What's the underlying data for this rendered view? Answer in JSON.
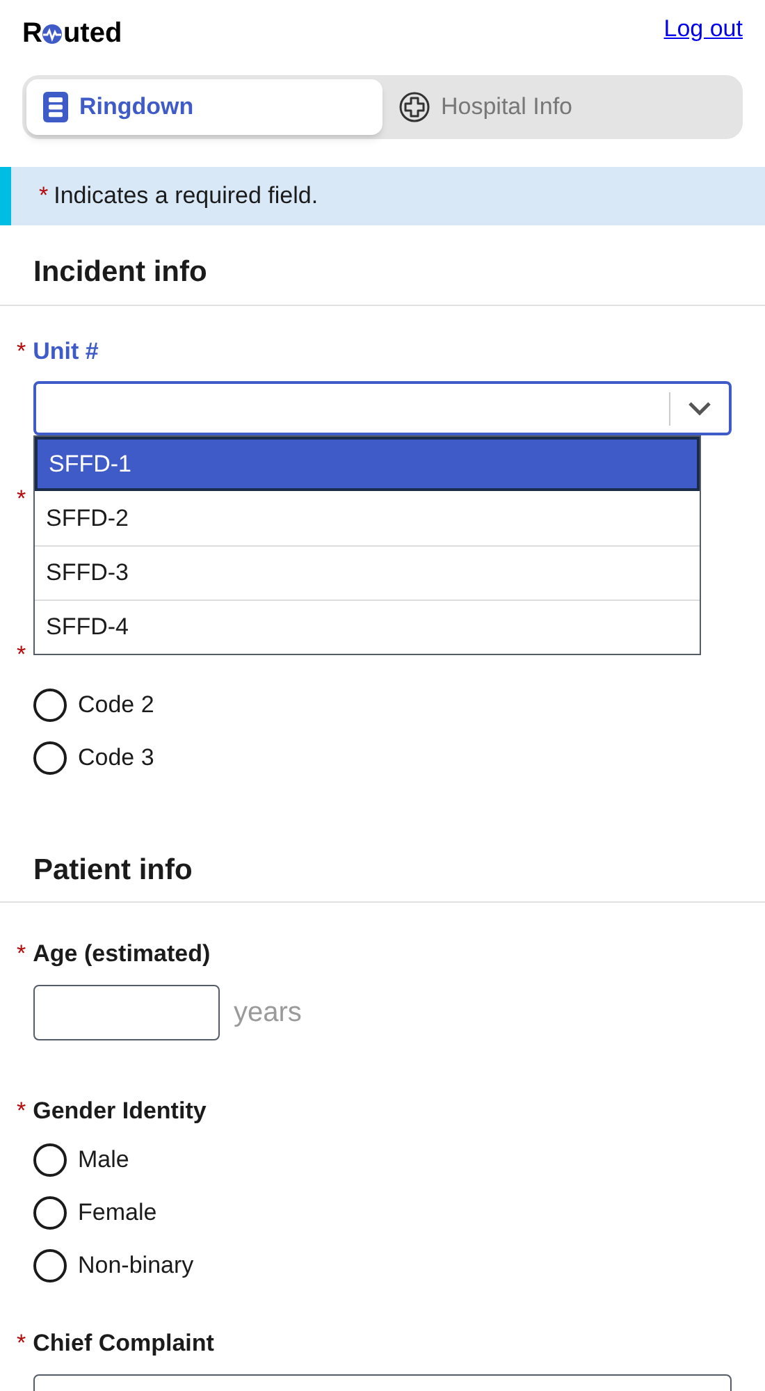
{
  "header": {
    "logo_start": "R",
    "logo_end": "uted",
    "logout": "Log out"
  },
  "tabs": [
    {
      "label": "Ringdown",
      "selected": true,
      "kind": "list"
    },
    {
      "label": "Hospital Info",
      "selected": false,
      "kind": "plus"
    }
  ],
  "notice": {
    "mark": "*",
    "text": "Indicates a required field."
  },
  "sections": [
    {
      "title": "Incident info",
      "fields": [
        {
          "kind": "select",
          "mark": "*",
          "label": "Unit #",
          "focused": true,
          "options": [
            {
              "label": "SFFD-1",
              "selected": true
            },
            {
              "label": "SFFD-2",
              "selected": false
            },
            {
              "label": "SFFD-3",
              "selected": false
            },
            {
              "label": "SFFD-4",
              "selected": false
            }
          ]
        },
        {
          "kind": "hidden",
          "mark": "*"
        },
        {
          "kind": "radio",
          "mark": "*",
          "options": [
            {
              "label": "Code 2",
              "selected": false
            },
            {
              "label": "Code 3",
              "selected": false
            }
          ]
        }
      ]
    },
    {
      "title": "Patient info",
      "fields": [
        {
          "kind": "number",
          "mark": "*",
          "label": "Age (estimated)",
          "unit": "years"
        },
        {
          "kind": "radio",
          "mark": "*",
          "label": "Gender Identity",
          "options": [
            {
              "label": "Male",
              "selected": false
            },
            {
              "label": "Female",
              "selected": false
            },
            {
              "label": "Non-binary",
              "selected": false
            }
          ]
        },
        {
          "kind": "textarea",
          "mark": "*",
          "label": "Chief Complaint"
        }
      ]
    }
  ]
}
